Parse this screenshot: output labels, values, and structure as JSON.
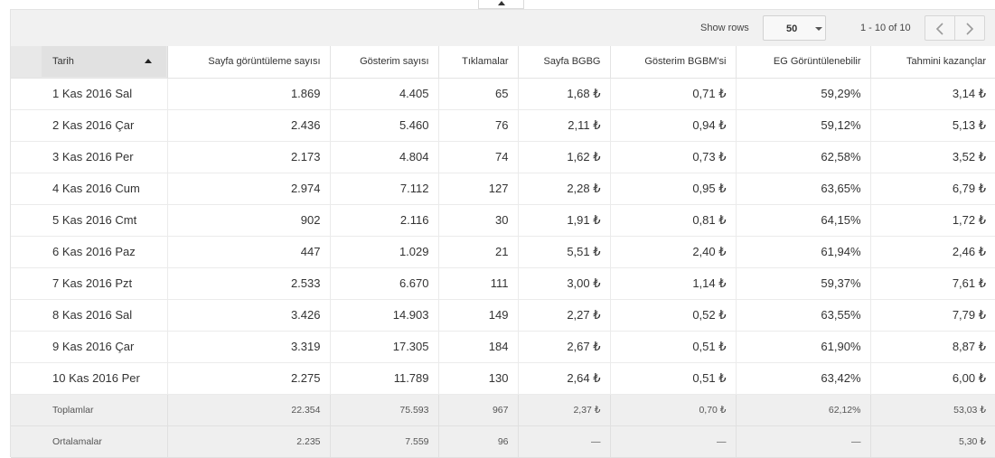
{
  "toolbar": {
    "show_rows_label": "Show rows",
    "rows_per_page": "50",
    "range_text": "1 - 10 of 10"
  },
  "table": {
    "columns": [
      "Tarih",
      "Sayfa görüntüleme sayısı",
      "Gösterim sayısı",
      "Tıklamalar",
      "Sayfa BGBG",
      "Gösterim BGBM'si",
      "EG Görüntülenebilir",
      "Tahmini kazançlar"
    ],
    "rows": [
      [
        "1 Kas 2016 Sal",
        "1.869",
        "4.405",
        "65",
        "1,68 ₺",
        "0,71 ₺",
        "59,29%",
        "3,14 ₺"
      ],
      [
        "2 Kas 2016 Çar",
        "2.436",
        "5.460",
        "76",
        "2,11 ₺",
        "0,94 ₺",
        "59,12%",
        "5,13 ₺"
      ],
      [
        "3 Kas 2016 Per",
        "2.173",
        "4.804",
        "74",
        "1,62 ₺",
        "0,73 ₺",
        "62,58%",
        "3,52 ₺"
      ],
      [
        "4 Kas 2016 Cum",
        "2.974",
        "7.112",
        "127",
        "2,28 ₺",
        "0,95 ₺",
        "63,65%",
        "6,79 ₺"
      ],
      [
        "5 Kas 2016 Cmt",
        "902",
        "2.116",
        "30",
        "1,91 ₺",
        "0,81 ₺",
        "64,15%",
        "1,72 ₺"
      ],
      [
        "6 Kas 2016 Paz",
        "447",
        "1.029",
        "21",
        "5,51 ₺",
        "2,40 ₺",
        "61,94%",
        "2,46 ₺"
      ],
      [
        "7 Kas 2016 Pzt",
        "2.533",
        "6.670",
        "111",
        "3,00 ₺",
        "1,14 ₺",
        "59,37%",
        "7,61 ₺"
      ],
      [
        "8 Kas 2016 Sal",
        "3.426",
        "14.903",
        "149",
        "2,27 ₺",
        "0,52 ₺",
        "63,55%",
        "7,79 ₺"
      ],
      [
        "9 Kas 2016 Çar",
        "3.319",
        "17.305",
        "184",
        "2,67 ₺",
        "0,51 ₺",
        "61,90%",
        "8,87 ₺"
      ],
      [
        "10 Kas 2016 Per",
        "2.275",
        "11.789",
        "130",
        "2,64 ₺",
        "0,51 ₺",
        "63,42%",
        "6,00 ₺"
      ]
    ],
    "totals": [
      "Toplamlar",
      "22.354",
      "75.593",
      "967",
      "2,37 ₺",
      "0,70 ₺",
      "62,12%",
      "53,03 ₺"
    ],
    "averages": [
      "Ortalamalar",
      "2.235",
      "7.559",
      "96",
      "—",
      "—",
      "—",
      "5,30 ₺"
    ]
  }
}
